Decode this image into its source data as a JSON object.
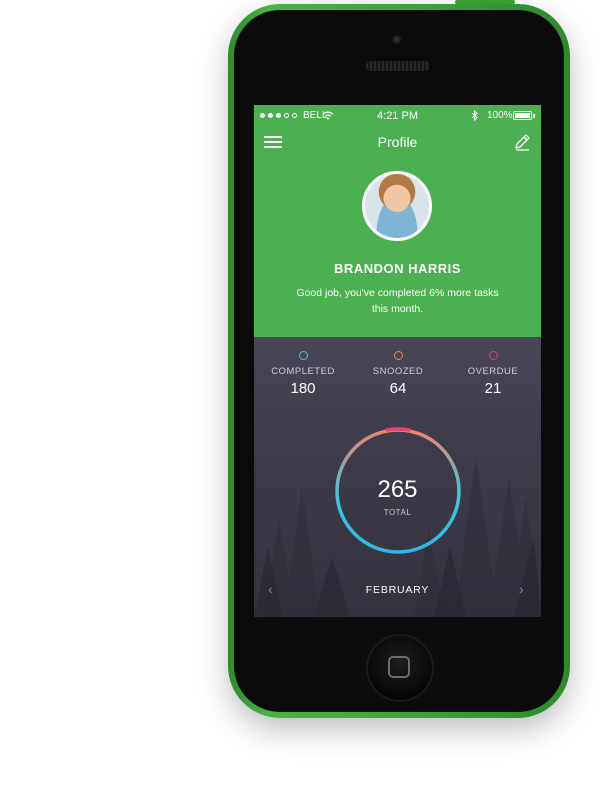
{
  "status_bar": {
    "carrier": "BELL",
    "time": "4:21 PM",
    "battery": "100%"
  },
  "nav": {
    "title": "Profile",
    "menu_icon": "hamburger-icon",
    "edit_icon": "pencil-icon"
  },
  "profile": {
    "name": "BRANDON HARRIS",
    "message": "Good job, you've completed 6% more tasks this month."
  },
  "stats": [
    {
      "label": "COMPLETED",
      "value": "180",
      "color": "#3ec6d8"
    },
    {
      "label": "SNOOZED",
      "value": "64",
      "color": "#f0846a"
    },
    {
      "label": "OVERDUE",
      "value": "21",
      "color": "#ea3d74"
    }
  ],
  "summary": {
    "total": "265",
    "total_label": "TOTAL"
  },
  "month_nav": {
    "month": "FEBRUARY",
    "prev": "‹",
    "next": "›"
  },
  "colors": {
    "accent_green": "#4caf50",
    "phone_green": "#3aa33a"
  }
}
